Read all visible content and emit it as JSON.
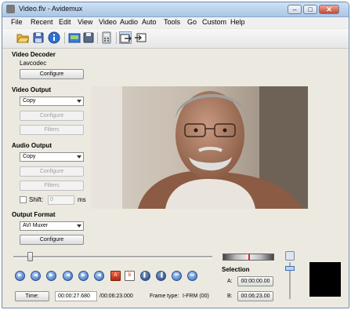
{
  "window": {
    "title": "Video.flv - Avidemux",
    "buttons": [
      "–",
      "□",
      "✕"
    ]
  },
  "menu": [
    "File",
    "Recent",
    "Edit",
    "View",
    "Video",
    "Audio",
    "Auto",
    "Tools",
    "Go",
    "Custom",
    "Help"
  ],
  "toolbar_icons": [
    "open-folder-icon",
    "save-disk-icon",
    "info-icon",
    "load-project-icon",
    "save-project-icon",
    "calculator-icon",
    "input-view-icon",
    "output-view-icon"
  ],
  "video_decoder": {
    "title": "Video Decoder",
    "codec": "Lavcodec",
    "configure": "Configure"
  },
  "video_output": {
    "title": "Video Output",
    "codec": "Copy",
    "configure": "Configure",
    "filters": "Filters"
  },
  "audio_output": {
    "title": "Audio Output",
    "codec": "Copy",
    "configure": "Configure",
    "filters": "Filters",
    "shift_label": "Shift:",
    "shift_value": "0",
    "shift_unit": "ms"
  },
  "output_format": {
    "title": "Output Format",
    "format": "AVI Muxer",
    "configure": "Configure"
  },
  "navigation": {
    "position_fraction": 0.07,
    "buttons": [
      "play",
      "previous-frame",
      "next-frame",
      "previous-keyframe",
      "next-keyframe",
      "previous-black",
      "set-marker-a",
      "set-marker-b",
      "goto-marker-a",
      "goto-marker-b",
      "first-frame",
      "last-frame"
    ]
  },
  "time": {
    "button": "Time:",
    "current": "00:00:27.680",
    "total": "/00:06:23.000",
    "frame_type_label": "Frame type:",
    "frame_type": "I-FRM (00)"
  },
  "selection": {
    "title": "Selection",
    "a_label": "A:",
    "a_value": "00:00:00.00",
    "b_label": "B:",
    "b_value": "00:06:23.00"
  },
  "colors": {
    "titlebar": "#aac6e6",
    "panel_bg": "#eceae0",
    "nav_blue": "#2c62b8",
    "preview_bg": "#000000"
  }
}
